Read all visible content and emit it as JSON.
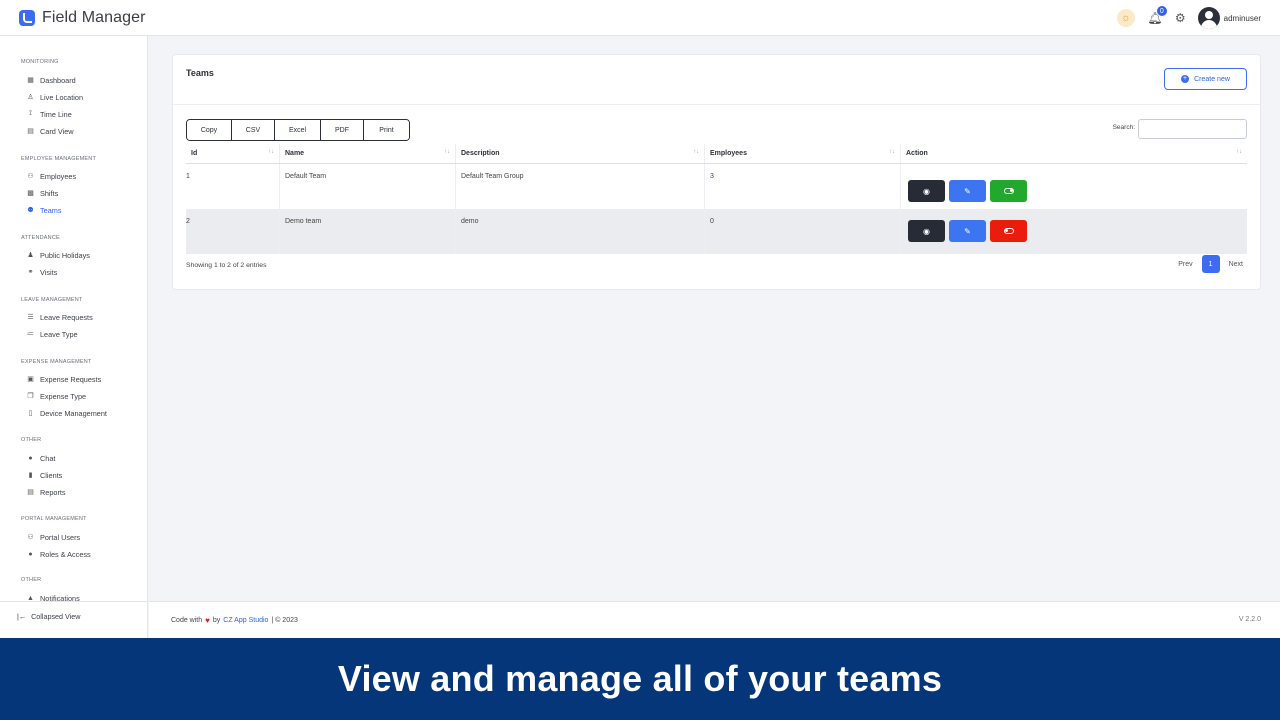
{
  "app": {
    "name": "Field Manager"
  },
  "header": {
    "notification_count": "0",
    "username": "adminuser"
  },
  "sidebar": {
    "sections": [
      {
        "title": "MONITORING",
        "items": [
          "Dashboard",
          "Live Location",
          "Time Line",
          "Card View"
        ]
      },
      {
        "title": "EMPLOYEE MANAGEMENT",
        "items": [
          "Employees",
          "Shifts",
          "Teams"
        ]
      },
      {
        "title": "ATTENDANCE",
        "items": [
          "Public Holidays",
          "Visits"
        ]
      },
      {
        "title": "LEAVE MANAGEMENT",
        "items": [
          "Leave Requests",
          "Leave Type"
        ]
      },
      {
        "title": "EXPENSE MANAGEMENT",
        "items": [
          "Expense Requests",
          "Expense Type",
          "Device Management"
        ]
      },
      {
        "title": "OTHER",
        "items": [
          "Chat",
          "Clients",
          "Reports"
        ]
      },
      {
        "title": "PORTAL MANAGEMENT",
        "items": [
          "Portal Users",
          "Roles & Access"
        ]
      },
      {
        "title": "OTHER",
        "items": [
          "Notifications"
        ]
      }
    ],
    "active_item": "Teams",
    "collapse_label": "Collapsed View"
  },
  "card": {
    "title": "Teams",
    "create_label": "Create new",
    "export_buttons": [
      "Copy",
      "CSV",
      "Excel",
      "PDF",
      "Print"
    ],
    "search_label": "Search:",
    "search_value": "",
    "columns": [
      "Id",
      "Name",
      "Description",
      "Employees",
      "Action"
    ],
    "rows": [
      {
        "id": "1",
        "name": "Default Team",
        "description": "Default Team Group",
        "employees": "3",
        "status": "active"
      },
      {
        "id": "2",
        "name": "Demo team",
        "description": "demo",
        "employees": "0",
        "status": "inactive"
      }
    ],
    "info": "Showing 1 to 2 of 2 entries",
    "pagination": {
      "prev": "Prev",
      "current": "1",
      "next": "Next"
    }
  },
  "footer": {
    "prefix": "Code with",
    "by": "by",
    "link": "CZ App Studio",
    "suffix": "|  © 2023",
    "version": "V 2.2.0"
  },
  "banner": {
    "text": "View and manage all of your teams"
  },
  "colors": {
    "primary": "#3d6cf0",
    "banner": "#05367a",
    "success": "#22a82d",
    "danger": "#ea1c0c",
    "dark": "#262b36"
  }
}
